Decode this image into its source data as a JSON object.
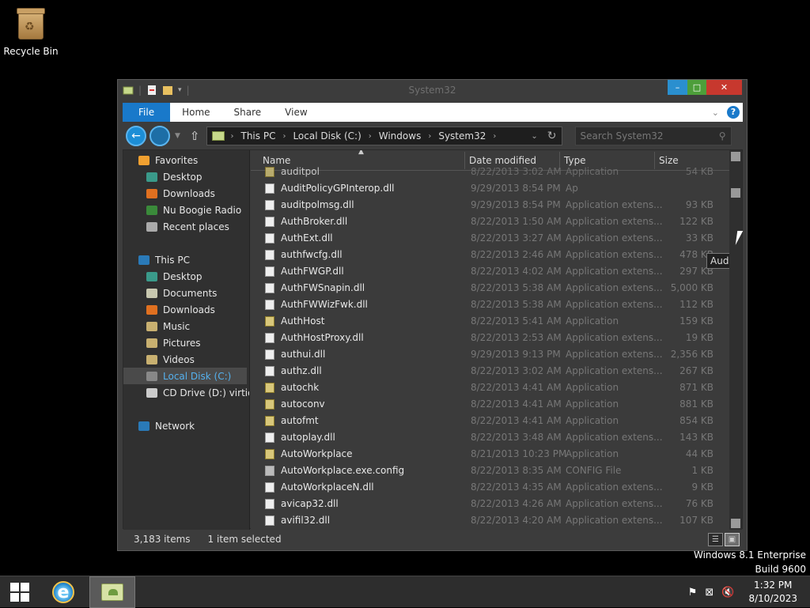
{
  "desktop": {
    "recycle_bin_label": "Recycle Bin",
    "watermark_line1": "Windows 8.1 Enterprise",
    "watermark_line2": "Build 9600"
  },
  "window": {
    "title": "System32",
    "controls": {
      "minimize": "–",
      "maximize": "□",
      "close": "✕"
    }
  },
  "ribbon": {
    "tabs": [
      {
        "label": "File",
        "active": true
      },
      {
        "label": "Home"
      },
      {
        "label": "Share"
      },
      {
        "label": "View"
      }
    ],
    "help": "?"
  },
  "address": {
    "breadcrumbs": [
      "This PC",
      "Local Disk (C:)",
      "Windows",
      "System32"
    ],
    "search_placeholder": "Search System32"
  },
  "navigation": {
    "items": [
      {
        "label": "Favorites",
        "icon": "favorites-star-icon",
        "color": "#f0a030",
        "indent": 0
      },
      {
        "label": "Desktop",
        "icon": "desktop-icon",
        "color": "#3a9a8a",
        "indent": 1
      },
      {
        "label": "Downloads",
        "icon": "downloads-arrow-icon",
        "color": "#e07020",
        "indent": 1
      },
      {
        "label": "Nu Boogie Radio",
        "icon": "shortcut-icon",
        "color": "#3a8a3a",
        "indent": 1
      },
      {
        "label": "Recent places",
        "icon": "recent-places-icon",
        "color": "#aaaaaa",
        "indent": 1
      },
      {
        "label": "This PC",
        "icon": "computer-icon",
        "color": "#2a7ab8",
        "indent": 0
      },
      {
        "label": "Desktop",
        "icon": "desktop-icon",
        "color": "#3a9a8a",
        "indent": 1
      },
      {
        "label": "Documents",
        "icon": "documents-icon",
        "color": "#c8c8b0",
        "indent": 1
      },
      {
        "label": "Downloads",
        "icon": "downloads-arrow-icon",
        "color": "#e07020",
        "indent": 1
      },
      {
        "label": "Music",
        "icon": "music-icon",
        "color": "#c8b070",
        "indent": 1
      },
      {
        "label": "Pictures",
        "icon": "pictures-icon",
        "color": "#c8b070",
        "indent": 1
      },
      {
        "label": "Videos",
        "icon": "videos-icon",
        "color": "#c8b070",
        "indent": 1
      },
      {
        "label": "Local Disk (C:)",
        "icon": "local-disk-icon",
        "color": "#888888",
        "indent": 1,
        "selected": true
      },
      {
        "label": "CD Drive (D:) virtio-w",
        "icon": "cd-drive-icon",
        "color": "#cccccc",
        "indent": 1
      },
      {
        "label": "Network",
        "icon": "network-icon",
        "color": "#2a7ab8",
        "indent": 0
      }
    ]
  },
  "columns": {
    "name": "Name",
    "date": "Date modified",
    "type": "Type",
    "size": "Size"
  },
  "files": [
    {
      "name": "auditpol",
      "date": "8/22/2013 3:02 AM",
      "type": "Application",
      "size": "54 KB",
      "kind": "exe",
      "partial": true
    },
    {
      "name": "AuditPolicyGPInterop.dll",
      "date": "9/29/2013 8:54 PM",
      "type": "Ap",
      "size": "",
      "kind": "dll"
    },
    {
      "name": "auditpolmsg.dll",
      "date": "9/29/2013 8:54 PM",
      "type": "Application extens...",
      "size": "93 KB",
      "kind": "dll"
    },
    {
      "name": "AuthBroker.dll",
      "date": "8/22/2013 1:50 AM",
      "type": "Application extens...",
      "size": "122 KB",
      "kind": "dll"
    },
    {
      "name": "AuthExt.dll",
      "date": "8/22/2013 3:27 AM",
      "type": "Application extens...",
      "size": "33 KB",
      "kind": "dll"
    },
    {
      "name": "authfwcfg.dll",
      "date": "8/22/2013 2:46 AM",
      "type": "Application extens...",
      "size": "478 KB",
      "kind": "dll"
    },
    {
      "name": "AuthFWGP.dll",
      "date": "8/22/2013 4:02 AM",
      "type": "Application extens...",
      "size": "297 KB",
      "kind": "dll"
    },
    {
      "name": "AuthFWSnapin.dll",
      "date": "8/22/2013 5:38 AM",
      "type": "Application extens...",
      "size": "5,000 KB",
      "kind": "dll"
    },
    {
      "name": "AuthFWWizFwk.dll",
      "date": "8/22/2013 5:38 AM",
      "type": "Application extens...",
      "size": "112 KB",
      "kind": "dll"
    },
    {
      "name": "AuthHost",
      "date": "8/22/2013 5:41 AM",
      "type": "Application",
      "size": "159 KB",
      "kind": "exe"
    },
    {
      "name": "AuthHostProxy.dll",
      "date": "8/22/2013 2:53 AM",
      "type": "Application extens...",
      "size": "19 KB",
      "kind": "dll"
    },
    {
      "name": "authui.dll",
      "date": "9/29/2013 9:13 PM",
      "type": "Application extens...",
      "size": "2,356 KB",
      "kind": "dll"
    },
    {
      "name": "authz.dll",
      "date": "8/22/2013 3:02 AM",
      "type": "Application extens...",
      "size": "267 KB",
      "kind": "dll"
    },
    {
      "name": "autochk",
      "date": "8/22/2013 4:41 AM",
      "type": "Application",
      "size": "871 KB",
      "kind": "exe"
    },
    {
      "name": "autoconv",
      "date": "8/22/2013 4:41 AM",
      "type": "Application",
      "size": "881 KB",
      "kind": "exe"
    },
    {
      "name": "autofmt",
      "date": "8/22/2013 4:41 AM",
      "type": "Application",
      "size": "854 KB",
      "kind": "exe"
    },
    {
      "name": "autoplay.dll",
      "date": "8/22/2013 3:48 AM",
      "type": "Application extens...",
      "size": "143 KB",
      "kind": "dll"
    },
    {
      "name": "AutoWorkplace",
      "date": "8/21/2013 10:23 PM",
      "type": "Application",
      "size": "44 KB",
      "kind": "exe"
    },
    {
      "name": "AutoWorkplace.exe.config",
      "date": "8/22/2013 8:35 AM",
      "type": "CONFIG File",
      "size": "1 KB",
      "kind": "cfg"
    },
    {
      "name": "AutoWorkplaceN.dll",
      "date": "8/22/2013 4:35 AM",
      "type": "Application extens...",
      "size": "9 KB",
      "kind": "dll"
    },
    {
      "name": "avicap32.dll",
      "date": "8/22/2013 4:26 AM",
      "type": "Application extens...",
      "size": "76 KB",
      "kind": "dll"
    },
    {
      "name": "avifil32.dll",
      "date": "8/22/2013 4:20 AM",
      "type": "Application extens...",
      "size": "107 KB",
      "kind": "dll"
    }
  ],
  "tooltip": "AuditPolicyGPInterop.dll",
  "status": {
    "item_count": "3,183 items",
    "selection": "1 item selected"
  },
  "taskbar": {
    "clock_time": "1:32 PM",
    "clock_date": "8/10/2023",
    "tray_icons": [
      "flag-icon",
      "network-status-icon",
      "volume-muted-icon"
    ]
  }
}
